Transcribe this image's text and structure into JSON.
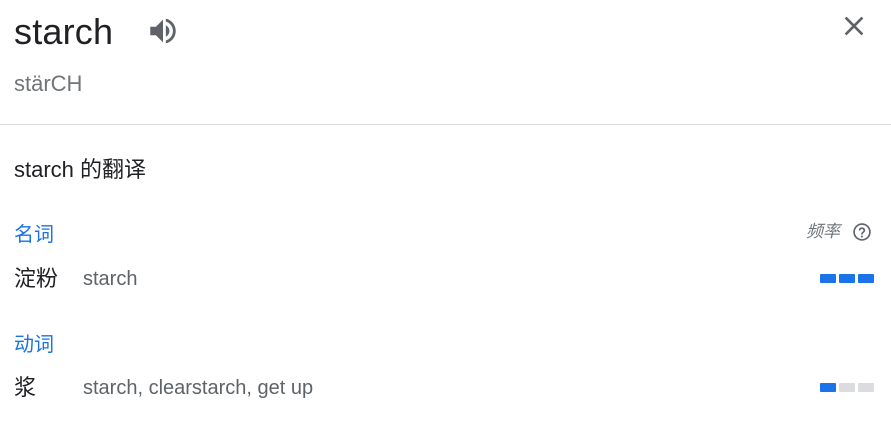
{
  "header": {
    "word": "starch",
    "phonetic": "stärCH",
    "speaker_icon": "speaker-volume-icon",
    "close_icon": "close-x-icon"
  },
  "translation_section": {
    "title": "starch 的翻译",
    "frequency_label": "频率",
    "help_icon": "help-circle-icon"
  },
  "groups": [
    {
      "part_of_speech": "名词",
      "entries": [
        {
          "word": "淀粉",
          "translations": "starch",
          "frequency": 3,
          "frequency_max": 3
        }
      ]
    },
    {
      "part_of_speech": "动词",
      "entries": [
        {
          "word": "浆",
          "translations": "starch, clearstarch, get up",
          "frequency": 1,
          "frequency_max": 3
        }
      ]
    }
  ],
  "colors": {
    "accent": "#1a73e8",
    "bar_inactive": "#dadce0",
    "text_primary": "#202124",
    "text_secondary": "#5f6368",
    "text_muted": "#70757a",
    "divider": "#dadce0"
  }
}
